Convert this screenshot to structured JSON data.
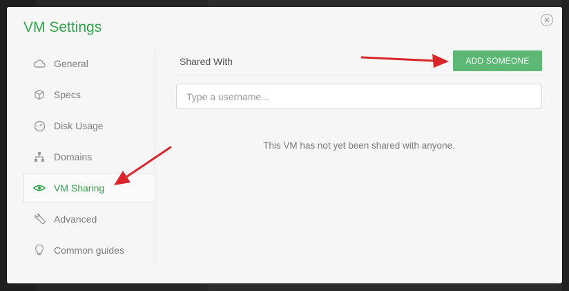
{
  "dialog": {
    "title": "VM Settings",
    "close_icon": "close-icon"
  },
  "sidebar": {
    "items": [
      {
        "label": "General",
        "icon": "cloud-icon"
      },
      {
        "label": "Specs",
        "icon": "cube-icon"
      },
      {
        "label": "Disk Usage",
        "icon": "gauge-icon"
      },
      {
        "label": "Domains",
        "icon": "sitemap-icon"
      },
      {
        "label": "VM Sharing",
        "icon": "share-eye-icon",
        "active": true
      },
      {
        "label": "Advanced",
        "icon": "wrench-icon"
      },
      {
        "label": "Common guides",
        "icon": "lightbulb-icon"
      }
    ]
  },
  "sharing": {
    "header_label": "Shared With",
    "add_button_label": "ADD SOMEONE",
    "search_placeholder": "Type a username...",
    "search_value": "",
    "empty_message": "This VM has not yet been shared with anyone."
  },
  "colors": {
    "accent": "#33a34d",
    "button_bg": "#5cb874",
    "annotation_arrow": "#d9262b"
  }
}
